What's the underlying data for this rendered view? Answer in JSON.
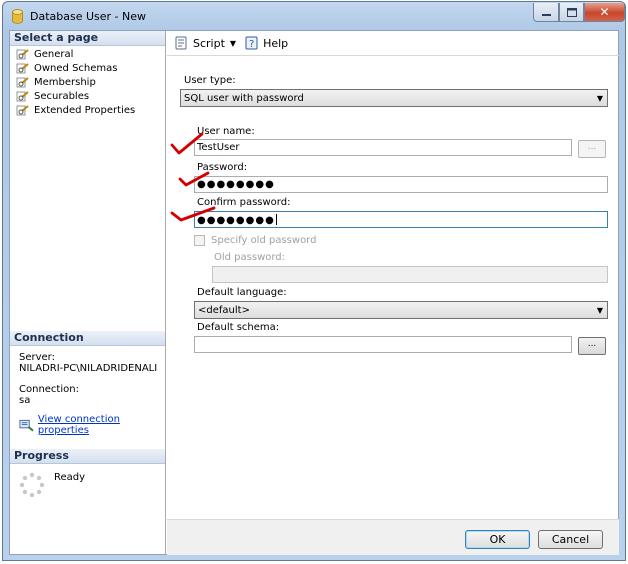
{
  "window": {
    "title": "Database User - New"
  },
  "titlebar_buttons": {
    "minimize_icon": "minimize-icon",
    "maximize_icon": "maximize-icon",
    "close_label": "✕"
  },
  "left_panel": {
    "select_page_header": "Select a page",
    "pages": [
      "General",
      "Owned Schemas",
      "Membership",
      "Securables",
      "Extended Properties"
    ],
    "connection_header": "Connection",
    "server_label": "Server:",
    "server_value": "NILADRI-PC\\NILADRIDENALI",
    "connection_label": "Connection:",
    "connection_value": "sa",
    "view_connection_link": "View connection properties",
    "progress_header": "Progress",
    "progress_status": "Ready"
  },
  "toolbar": {
    "script_label": "Script",
    "help_label": "Help"
  },
  "form": {
    "user_type_label": "User type:",
    "user_type_value": "SQL user with password",
    "user_name_label": "User name:",
    "user_name_value": "TestUser",
    "browse_label": "...",
    "password_label": "Password:",
    "password_value": "●●●●●●●●",
    "confirm_password_label": "Confirm password:",
    "confirm_password_value": "●●●●●●●●",
    "specify_old_password_label": "Specify old password",
    "old_password_label": "Old password:",
    "default_language_label": "Default language:",
    "default_language_value": "<default>",
    "default_schema_label": "Default schema:",
    "default_schema_value": ""
  },
  "buttons": {
    "ok": "OK",
    "cancel": "Cancel"
  },
  "colors": {
    "annotation_checkmark": "#d40000",
    "link": "#0033cc",
    "title_bar": "#b9d1ec",
    "close_button": "#c9462c"
  }
}
